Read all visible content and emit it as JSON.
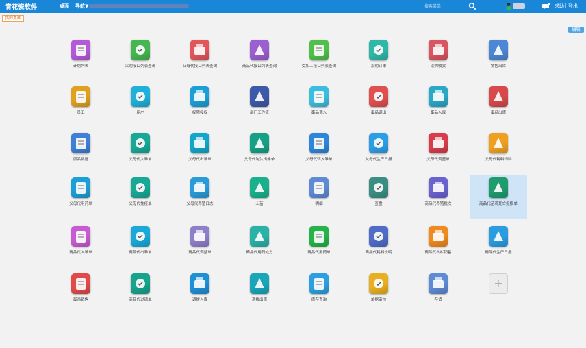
{
  "header": {
    "brand": "青花瓷软件",
    "nav_desk": "桌面",
    "nav_guide": "导航▼",
    "search_placeholder": "搜索菜单",
    "help": "求助",
    "separator": "|",
    "logout": "登出"
  },
  "tab": {
    "label": "我的桌面"
  },
  "toolbar": {
    "edit_label": "编辑"
  },
  "colors": {
    "topbar": "#1a86d8",
    "tab_accent": "#e0752a",
    "selected": "#cfe4f7"
  },
  "items": [
    {
      "label": "计划列表",
      "icon": "plan-list-icon",
      "color": "#b35ad8"
    },
    {
      "label": "采购接口列表查询",
      "icon": "purchase-list-icon",
      "color": "#46b650"
    },
    {
      "label": "父母代接口列表查询",
      "icon": "parent-list-icon",
      "color": "#e2565a"
    },
    {
      "label": "商品代接口列表查询",
      "icon": "product-list-icon",
      "color": "#9a5fd0"
    },
    {
      "label": "受加工接口列表查询",
      "icon": "process-list-icon",
      "color": "#50c04a"
    },
    {
      "label": "采购订单",
      "icon": "purchase-order-icon",
      "color": "#2fb8a8"
    },
    {
      "label": "采购收货",
      "icon": "receiving-truck-icon",
      "color": "#d95560"
    },
    {
      "label": "销售出库",
      "icon": "sales-outbound-icon",
      "color": "#4b87d4"
    },
    {
      "label": "员工",
      "icon": "employee-icon",
      "color": "#e0a020"
    },
    {
      "label": "用户",
      "icon": "user-icon",
      "color": "#1fb1d9"
    },
    {
      "label": "权限授权",
      "icon": "permission-icon",
      "color": "#1c9fd6"
    },
    {
      "label": "部门工作流",
      "icon": "workflow-icon",
      "color": "#3d5aa8"
    },
    {
      "label": "蛋品调入",
      "icon": "egg-in-icon",
      "color": "#3bbde0"
    },
    {
      "label": "蛋品调出",
      "icon": "egg-out-icon",
      "color": "#e24f4f"
    },
    {
      "label": "蛋品入库",
      "icon": "egg-storage-icon",
      "color": "#2aa8c8"
    },
    {
      "label": "蛋品出库",
      "icon": "egg-outbound-icon",
      "color": "#d84a4a"
    },
    {
      "label": "蛋品挑选",
      "icon": "egg-select-icon",
      "color": "#3f7fd6"
    },
    {
      "label": "父母代入雏单",
      "icon": "parent-chick-in-icon",
      "color": "#17a896"
    },
    {
      "label": "父母代出雏单",
      "icon": "parent-chick-out-icon",
      "color": "#12a6c8"
    },
    {
      "label": "父母代淘汰出雏单",
      "icon": "parent-cull-icon",
      "color": "#16a085"
    },
    {
      "label": "父母代转入雏单",
      "icon": "parent-transfer-icon",
      "color": "#2d86d9"
    },
    {
      "label": "父母代生产日报",
      "icon": "parent-daily-icon",
      "color": "#2c9ee6"
    },
    {
      "label": "父母代调整单",
      "icon": "parent-adjust-icon",
      "color": "#d83c4c"
    },
    {
      "label": "父母代耗料饲料",
      "icon": "parent-feed-icon",
      "color": "#f0a020"
    },
    {
      "label": "父母代用药单",
      "icon": "parent-medicine-icon",
      "color": "#1c9fd6"
    },
    {
      "label": "父母代免疫单",
      "icon": "parent-vaccine-icon",
      "color": "#17a896"
    },
    {
      "label": "父母代养殖日志",
      "icon": "parent-log-icon",
      "color": "#2a9ad8"
    },
    {
      "label": "上苗",
      "icon": "seedling-icon",
      "color": "#1ab08e"
    },
    {
      "label": "明细",
      "icon": "detail-icon",
      "color": "#5f8ad4"
    },
    {
      "label": "查盘",
      "icon": "inventory-check-icon",
      "color": "#3a8f82"
    },
    {
      "label": "商品代养殖批次",
      "icon": "product-batch-icon",
      "color": "#6a62cf"
    },
    {
      "label": "商品代苗鸡死亡报损单",
      "icon": "product-loss-icon",
      "color": "#1e9c6e"
    },
    {
      "label": "商品代入雏单",
      "icon": "product-chick-in-icon",
      "color": "#c85ad2"
    },
    {
      "label": "商品代出雏单",
      "icon": "product-chick-out-icon",
      "color": "#1aa9d8"
    },
    {
      "label": "商品代调整单",
      "icon": "product-adjust-icon",
      "color": "#8e7fc8"
    },
    {
      "label": "商品代用药处方",
      "icon": "product-prescription-icon",
      "color": "#2bb2a8"
    },
    {
      "label": "商品代用药单",
      "icon": "product-medicine-icon",
      "color": "#27b24a"
    },
    {
      "label": "商品代耗料说明",
      "icon": "product-feed-note-icon",
      "color": "#4f6cc8"
    },
    {
      "label": "商品代出栏销售",
      "icon": "product-sale-icon",
      "color": "#f08a1e"
    },
    {
      "label": "商品代生产日报",
      "icon": "product-daily-icon",
      "color": "#2a9de0"
    },
    {
      "label": "蛋鸡销售",
      "icon": "layer-sales-icon",
      "color": "#e24a4a"
    },
    {
      "label": "商品代过磅单",
      "icon": "weighing-icon",
      "color": "#17a48c"
    },
    {
      "label": "调拨入库",
      "icon": "transfer-in-icon",
      "color": "#1f8fd6"
    },
    {
      "label": "调拨出库",
      "icon": "transfer-out-icon",
      "color": "#19a6b8"
    },
    {
      "label": "库存查询",
      "icon": "stock-query-icon",
      "color": "#2c9fe0"
    },
    {
      "label": "单据审核",
      "icon": "document-audit-icon",
      "color": "#e8b020"
    },
    {
      "label": "存货",
      "icon": "stock-box-icon",
      "color": "#5f8ad4"
    }
  ],
  "add_button": "+"
}
